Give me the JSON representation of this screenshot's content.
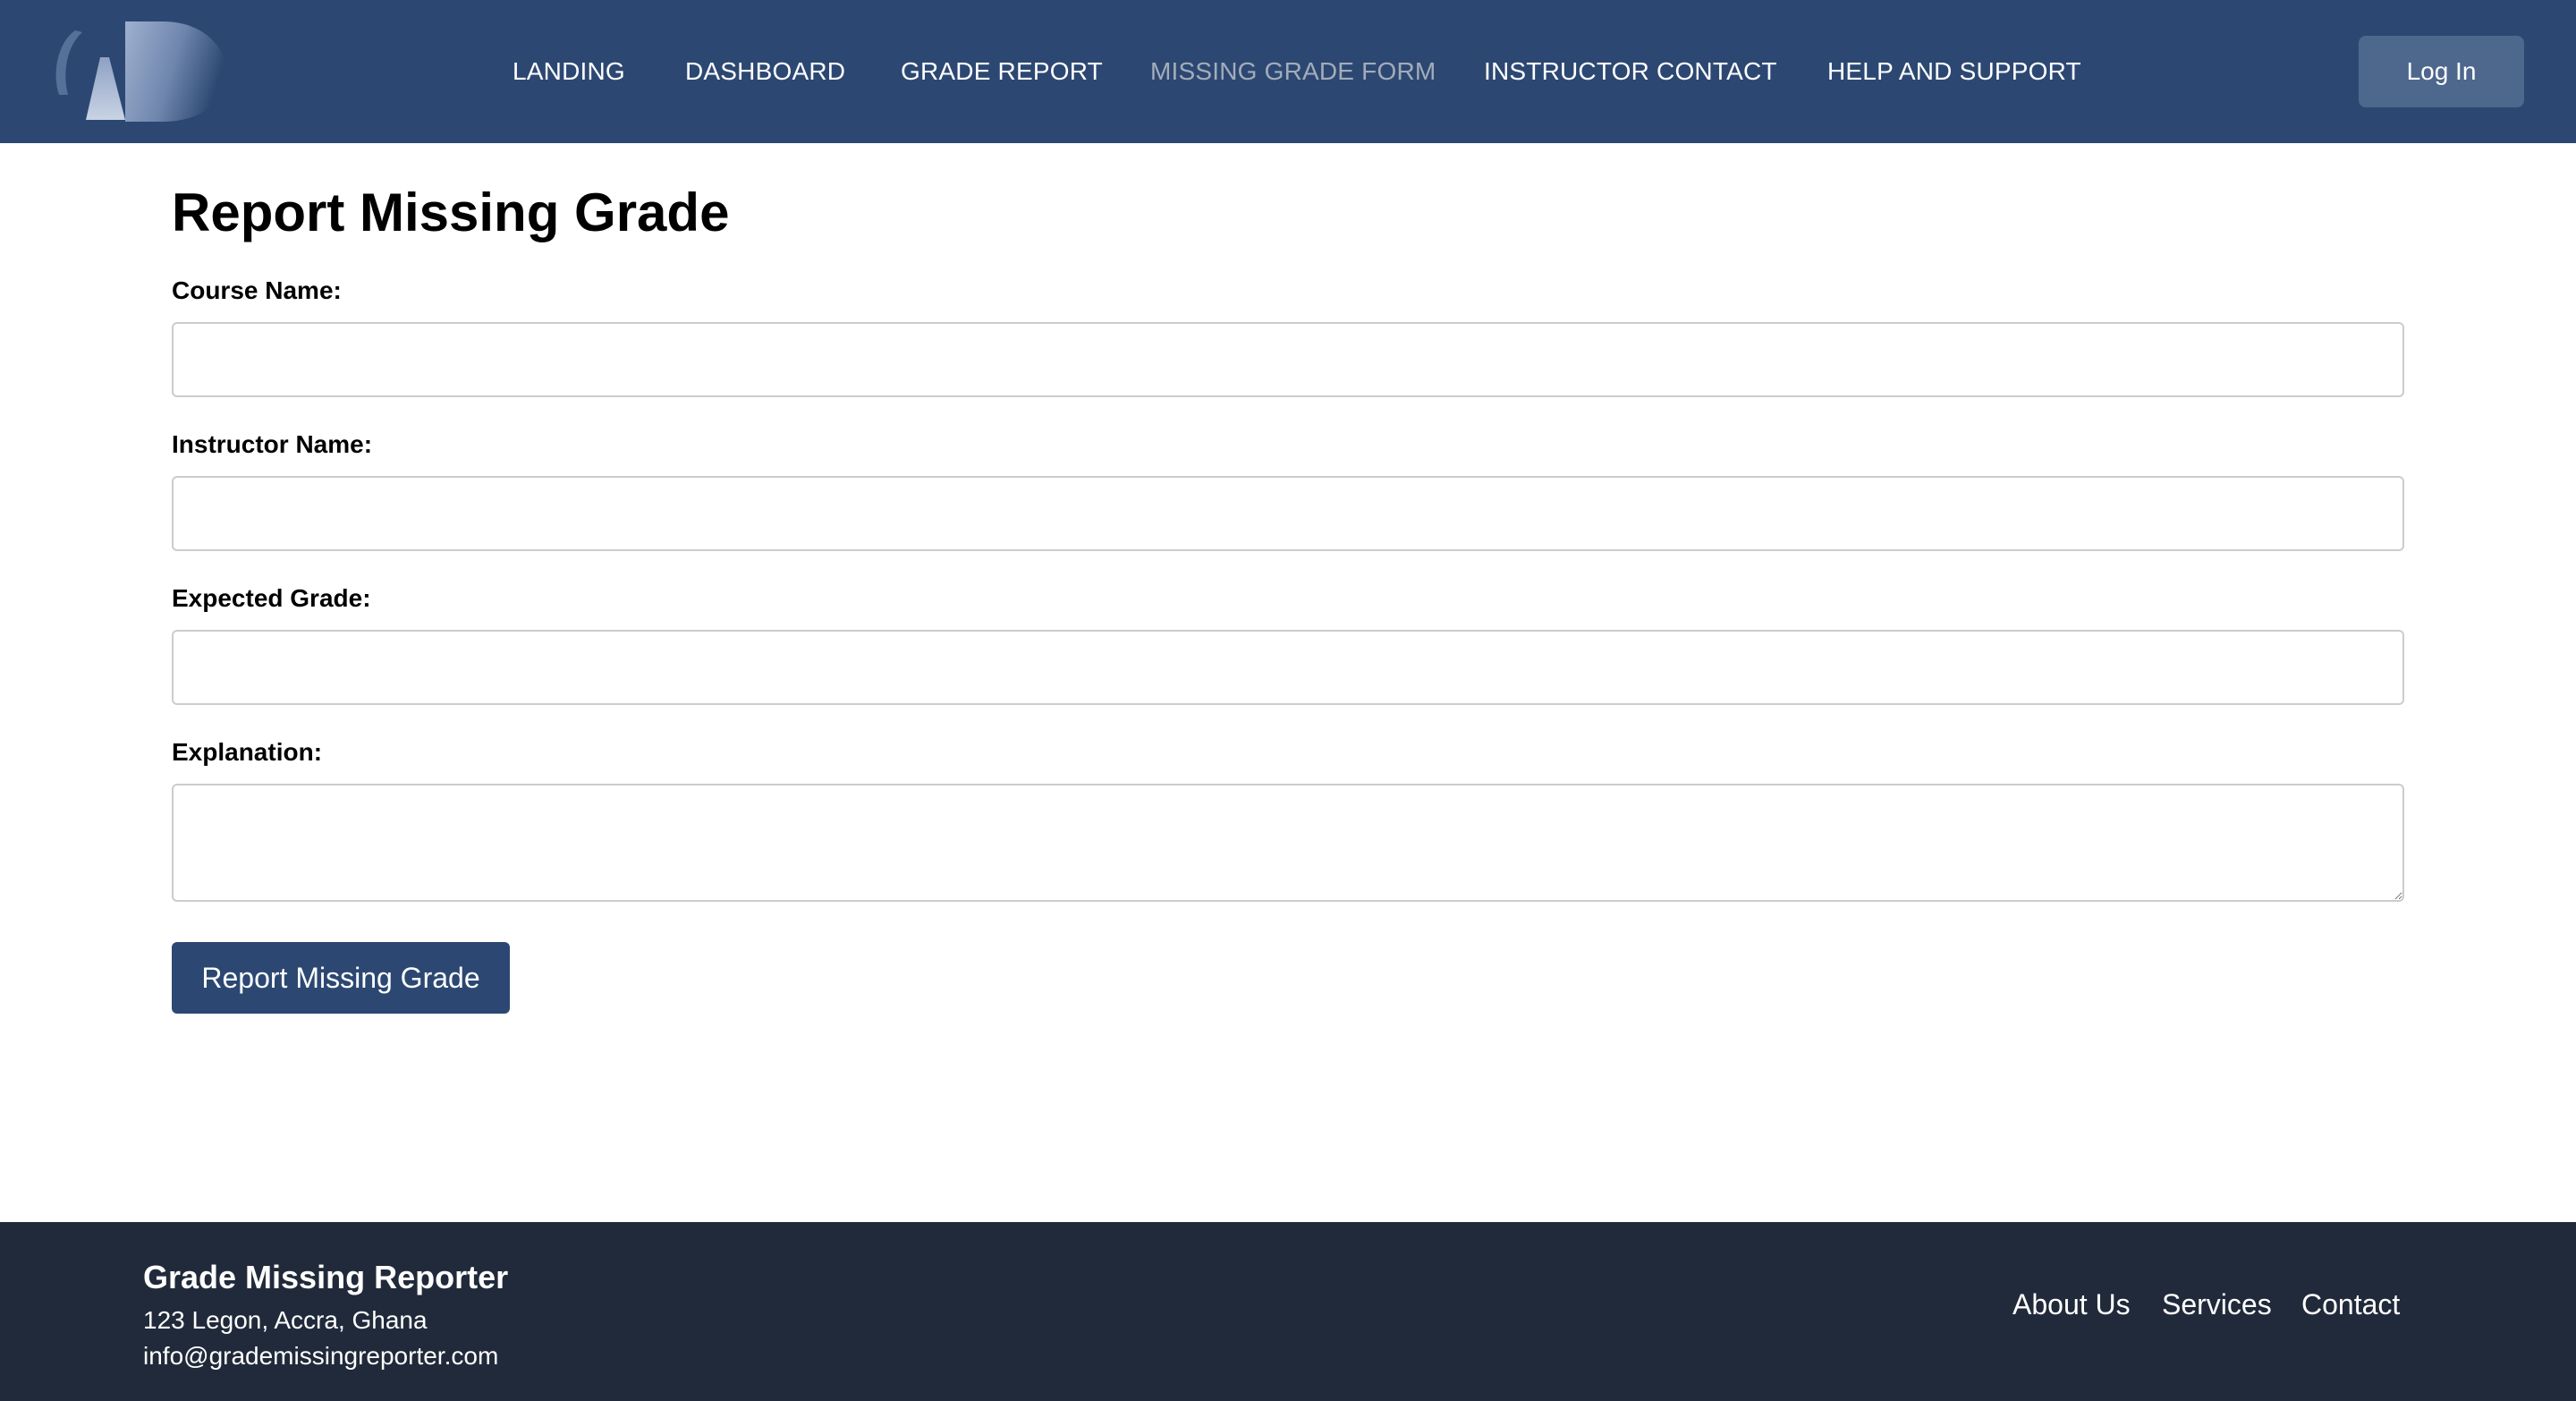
{
  "header": {
    "nav": [
      {
        "label": "LANDING"
      },
      {
        "label": "DASHBOARD"
      },
      {
        "label": "GRADE REPORT"
      },
      {
        "label": "MISSING GRADE FORM",
        "active": true
      },
      {
        "label": "INSTRUCTOR CONTACT"
      },
      {
        "label": "HELP AND SUPPORT"
      }
    ],
    "login_label": "Log In"
  },
  "form": {
    "title": "Report Missing Grade",
    "fields": [
      {
        "label": "Course Name:",
        "value": ""
      },
      {
        "label": "Instructor Name:",
        "value": ""
      },
      {
        "label": "Expected Grade:",
        "value": ""
      },
      {
        "label": "Explanation:",
        "value": ""
      }
    ],
    "submit_label": "Report Missing Grade"
  },
  "footer": {
    "brand": "Grade Missing Reporter",
    "address": "123 Legon, Accra, Ghana",
    "email": "info@grademissingreporter.com",
    "links": [
      {
        "label": "About Us"
      },
      {
        "label": "Services"
      },
      {
        "label": "Contact"
      }
    ]
  },
  "colors": {
    "header_bg": "#2c4872",
    "nav_active": "#a3acba",
    "login_bg": "#4e678d",
    "button_bg": "#2c4872",
    "footer_bg": "#212a3a"
  },
  "icons": {
    "logo": "ad-monogram-logo"
  }
}
